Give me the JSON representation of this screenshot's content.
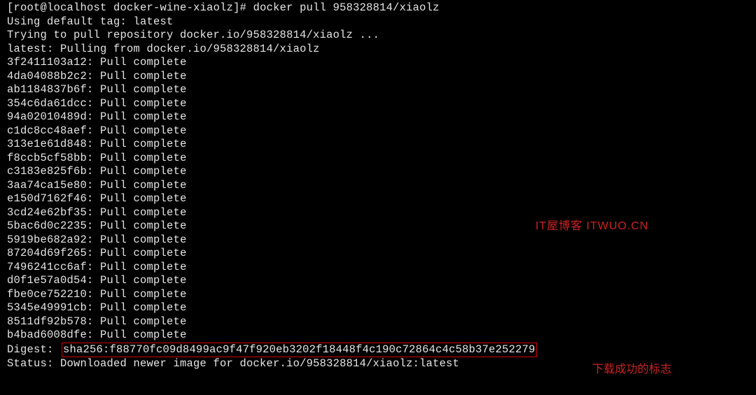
{
  "prompt": {
    "user_host": "[root@localhost",
    "cwd": "docker-wine-xiaolz]#",
    "command": "docker pull 958328814/xiaolz"
  },
  "lines": {
    "default_tag": "Using default tag: latest",
    "trying": "Trying to pull repository docker.io/958328814/xiaolz ...",
    "pulling_from": "latest: Pulling from docker.io/958328814/xiaolz"
  },
  "layers": [
    {
      "hash": "3f2411103a12",
      "status": "Pull complete"
    },
    {
      "hash": "4da04088b2c2",
      "status": "Pull complete"
    },
    {
      "hash": "ab1184837b6f",
      "status": "Pull complete"
    },
    {
      "hash": "354c6da61dcc",
      "status": "Pull complete"
    },
    {
      "hash": "94a02010489d",
      "status": "Pull complete"
    },
    {
      "hash": "c1dc8cc48aef",
      "status": "Pull complete"
    },
    {
      "hash": "313e1e61d848",
      "status": "Pull complete"
    },
    {
      "hash": "f8ccb5cf58bb",
      "status": "Pull complete"
    },
    {
      "hash": "c3183e825f6b",
      "status": "Pull complete"
    },
    {
      "hash": "3aa74ca15e80",
      "status": "Pull complete"
    },
    {
      "hash": "e150d7162f46",
      "status": "Pull complete"
    },
    {
      "hash": "3cd24e62bf35",
      "status": "Pull complete"
    },
    {
      "hash": "5bac6d0c2235",
      "status": "Pull complete"
    },
    {
      "hash": "5919be682a92",
      "status": "Pull complete"
    },
    {
      "hash": "87204d69f265",
      "status": "Pull complete"
    },
    {
      "hash": "7496241cc6af",
      "status": "Pull complete"
    },
    {
      "hash": "d0f1e57a0d54",
      "status": "Pull complete"
    },
    {
      "hash": "fbe0ce752210",
      "status": "Pull complete"
    },
    {
      "hash": "5345e49991cb",
      "status": "Pull complete"
    },
    {
      "hash": "8511df92b578",
      "status": "Pull complete"
    },
    {
      "hash": "b4bad6008dfe",
      "status": "Pull complete"
    }
  ],
  "digest": {
    "label": "Digest:",
    "value": "sha256:f88770fc09d8499ac9f47f920eb3202f18448f4c190c72864c4c58b37e252279"
  },
  "status_line": "Status: Downloaded newer image for docker.io/958328814/xiaolz:latest",
  "watermark_text": "IT屋博客 ITWUO.CN",
  "annotation_text": "下载成功的标志"
}
